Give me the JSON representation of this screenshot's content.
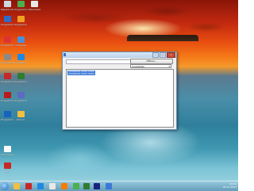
{
  "window": {
    "title": "",
    "open_button_label": "Öffnen...",
    "dropdown_selected": "Auswählen",
    "list_items": [
      "00000000-0000-0000",
      "00000000-0000-0000"
    ]
  },
  "desktop_icons": [
    {
      "label": "Papierkorb",
      "icon": "recycle-bin-icon",
      "color": "#cfd8e0"
    },
    {
      "label": "Programm",
      "icon": "app-icon",
      "color": "#4caf50"
    },
    {
      "label": "Dokument",
      "icon": "document-icon",
      "color": "#e8e8e8"
    },
    {
      "label": "Programm",
      "icon": "app-icon",
      "color": "#2d6cc7"
    },
    {
      "label": "Programm",
      "icon": "app-icon",
      "color": "#f0a020"
    },
    {
      "label": "Programm",
      "icon": "app-icon",
      "color": "#d33"
    },
    {
      "label": "Computer",
      "icon": "computer-icon",
      "color": "#4a90d9"
    },
    {
      "label": "Programm",
      "icon": "app-icon",
      "color": "#8a8a8a"
    },
    {
      "label": "Programm",
      "icon": "app-icon",
      "color": "#1e88e5"
    },
    {
      "label": "Programm",
      "icon": "app-icon",
      "color": "#c62828"
    },
    {
      "label": "Programm",
      "icon": "app-icon",
      "color": "#2e7d32"
    },
    {
      "label": "Programm",
      "icon": "app-icon",
      "color": "#b71c1c"
    },
    {
      "label": "Programm",
      "icon": "app-icon",
      "color": "#5c6bc0"
    },
    {
      "label": "Programm",
      "icon": "app-icon",
      "color": "#1565c0"
    },
    {
      "label": "Ordner",
      "icon": "folder-icon",
      "color": "#f0c040"
    },
    {
      "label": "Dokument",
      "icon": "document-icon",
      "color": "#fafafa"
    },
    {
      "label": "PDF",
      "icon": "pdf-icon",
      "color": "#c62828"
    }
  ],
  "taskbar": {
    "clock_time": "16:22",
    "clock_date": "29.11.2013"
  },
  "colors": {
    "accent": "#3b79d6",
    "close": "#c94c3b"
  }
}
